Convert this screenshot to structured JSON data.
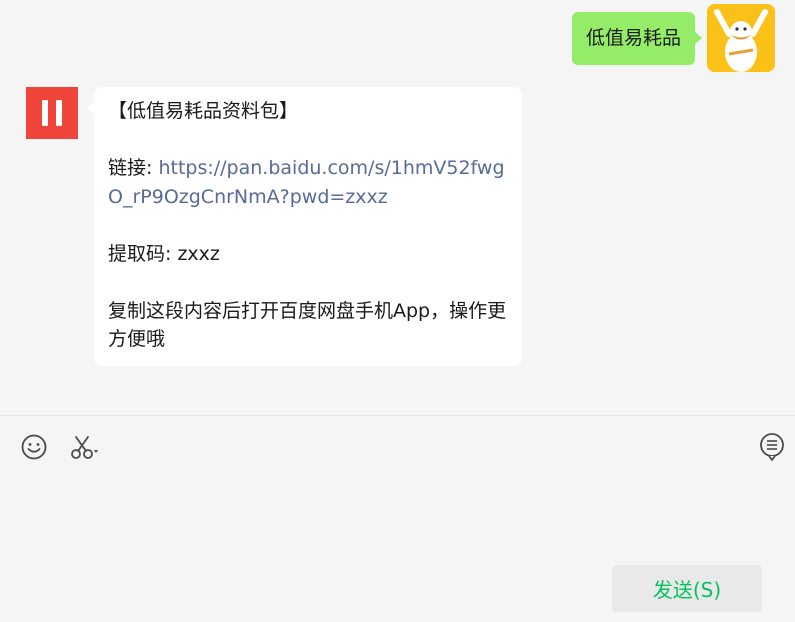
{
  "chat": {
    "outgoing": {
      "text": "低值易耗品",
      "bubble_color": "#95ec69"
    },
    "incoming": {
      "avatar_color": "#f0453a",
      "title": "【低值易耗品资料包】",
      "link_label": "链接: ",
      "link_url": "https://pan.baidu.com/s/1hmV52fwgO_rP9OzgCnrNmA?pwd=zxxz",
      "code_label": "提取码: ",
      "code_value": "zxxz",
      "instruction": "复制这段内容后打开百度网盘手机App，操作更方便哦",
      "link_color": "#576b95"
    }
  },
  "toolbar": {
    "icons": [
      "emoji-icon",
      "scissors-icon",
      "chat-history-icon"
    ]
  },
  "composer": {
    "send_label": "发送(S)",
    "send_color": "#07c160"
  }
}
